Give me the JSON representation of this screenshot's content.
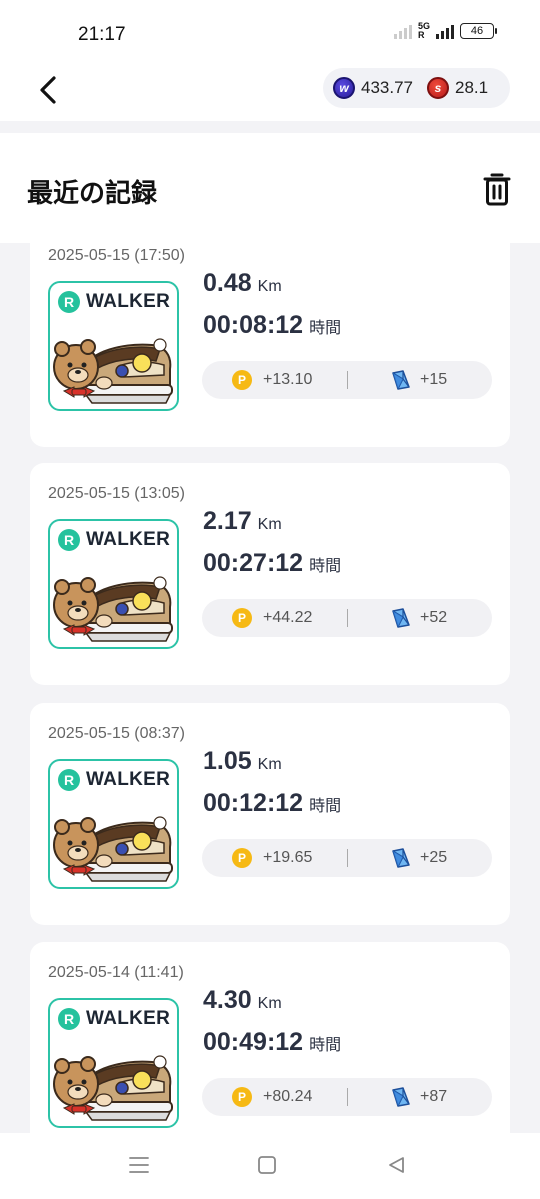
{
  "status": {
    "time": "21:17",
    "battery": "46",
    "net": "5G",
    "net_sub": "R"
  },
  "header": {
    "balances": [
      {
        "icon": "w-coin-icon",
        "value": "433.77",
        "color": "#2a1d9c"
      },
      {
        "icon": "s-coin-icon",
        "value": "28.1",
        "color": "#b81c1c"
      }
    ]
  },
  "section": {
    "title": "最近の記録"
  },
  "records": [
    {
      "date": "2025-05-15 (17:50)",
      "brand": "WALKER",
      "brand_badge": "R",
      "distance": "0.48",
      "distance_unit": "Km",
      "duration": "00:08:12",
      "duration_unit": "時間",
      "points": "+13.10",
      "gems": "+15"
    },
    {
      "date": "2025-05-15 (13:05)",
      "brand": "WALKER",
      "brand_badge": "R",
      "distance": "2.17",
      "distance_unit": "Km",
      "duration": "00:27:12",
      "duration_unit": "時間",
      "points": "+44.22",
      "gems": "+52"
    },
    {
      "date": "2025-05-15 (08:37)",
      "brand": "WALKER",
      "brand_badge": "R",
      "distance": "1.05",
      "distance_unit": "Km",
      "duration": "00:12:12",
      "duration_unit": "時間",
      "points": "+19.65",
      "gems": "+25"
    },
    {
      "date": "2025-05-14 (11:41)",
      "brand": "WALKER",
      "brand_badge": "R",
      "distance": "4.30",
      "distance_unit": "Km",
      "duration": "00:49:12",
      "duration_unit": "時間",
      "points": "+80.24",
      "gems": "+87"
    }
  ],
  "reward_icons": {
    "points": "P",
    "gem": "blue-gem-icon"
  },
  "colors": {
    "accent_teal": "#2cc3a7",
    "point_gold": "#f6b914",
    "gem_blue": "#2e7bd6"
  },
  "navbar": {
    "buttons": [
      "recents-button",
      "home-button",
      "back-nav-button"
    ]
  }
}
